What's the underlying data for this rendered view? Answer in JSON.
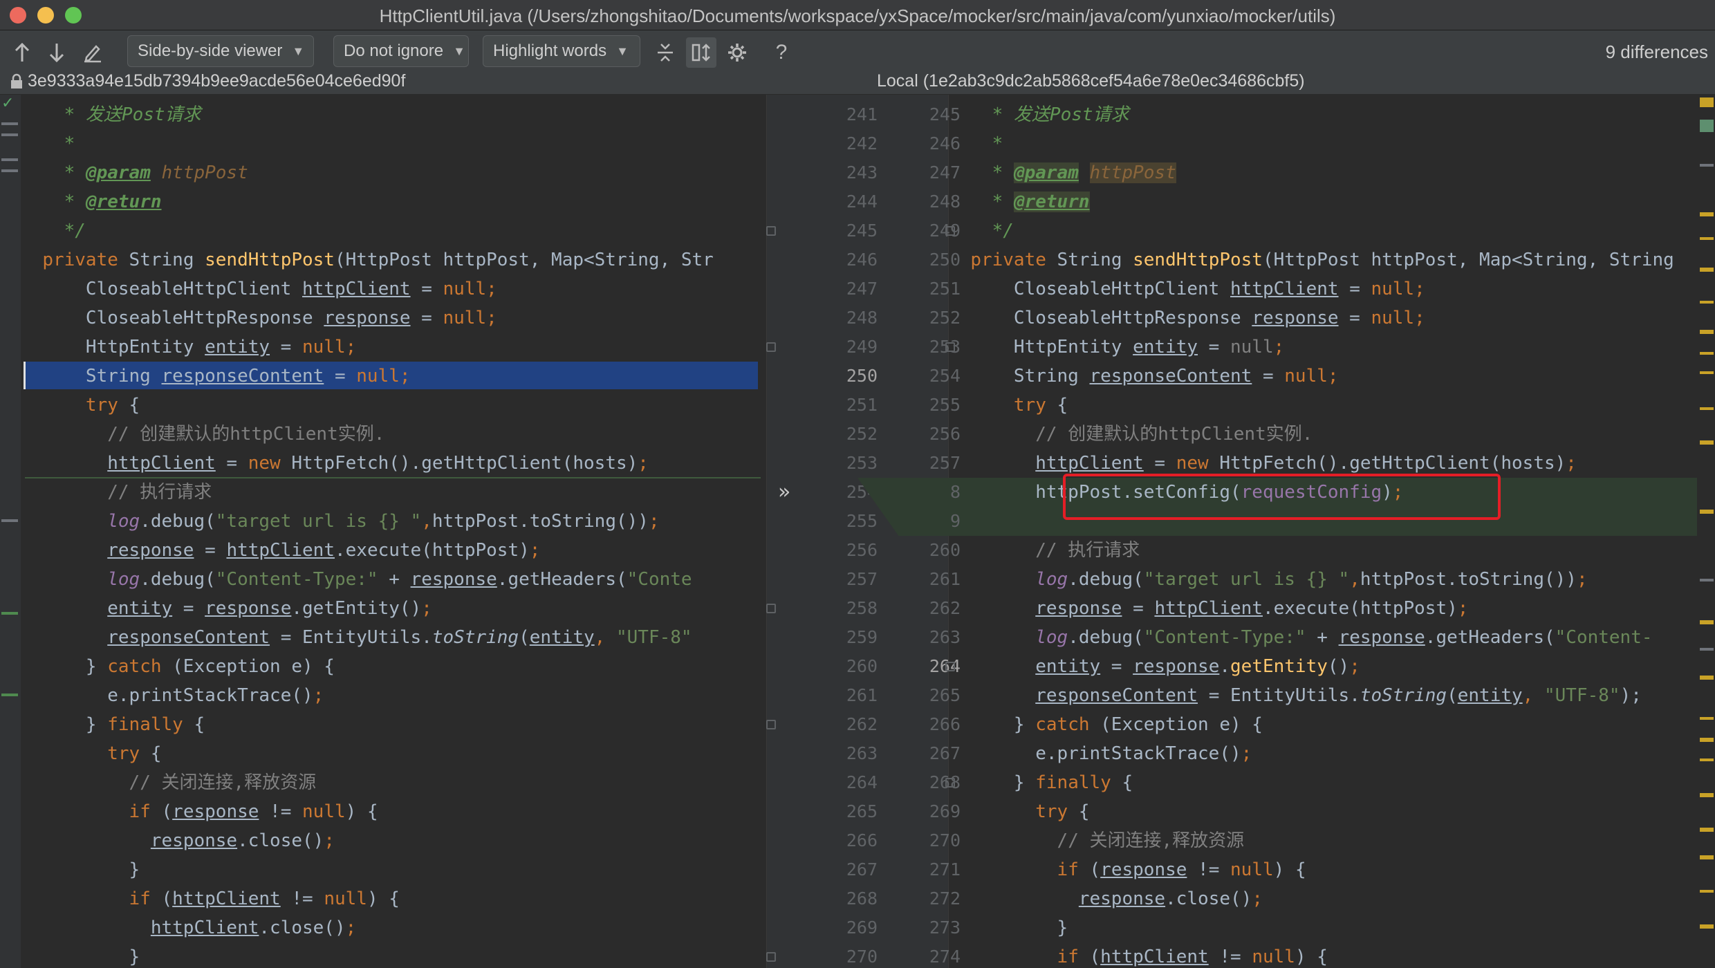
{
  "window": {
    "title": "HttpClientUtil.java (/Users/zhongshitao/Documents/workspace/yxSpace/mocker/src/main/java/com/yunxiao/mocker/utils)"
  },
  "toolbar": {
    "viewer": "Side-by-side viewer",
    "ignore": "Do not ignore",
    "highlight": "Highlight words",
    "differences": "9 differences",
    "help": "?"
  },
  "revisions": {
    "left": "3e9333a94e15db7394b9ee9acde56e04ce6ed90f",
    "right": "Local (1e2ab3c9dc2ab5868cef54a6e78e0ec34686cbf5)"
  },
  "colors": {
    "accent_selection": "#214283",
    "inserted_bg": "#2f3d30",
    "annotation_box": "#e41e26"
  },
  "icons": [
    "lock-icon",
    "arrow-up-icon",
    "arrow-down-icon",
    "edit-icon",
    "collapse-icon",
    "sync-scroll-icon",
    "gear-icon",
    "help-icon",
    "checkmark-icon",
    "apply-change-icon"
  ],
  "gutter": {
    "left_numbers": [
      241,
      242,
      243,
      244,
      245,
      246,
      247,
      248,
      249,
      250,
      251,
      252,
      253,
      254,
      255,
      256,
      257,
      258,
      259,
      260,
      261,
      262,
      263,
      264,
      265,
      266,
      267,
      268,
      269,
      270
    ],
    "right_numbers": [
      245,
      246,
      247,
      248,
      249,
      250,
      251,
      252,
      253,
      254,
      255,
      256,
      257,
      258,
      259,
      260,
      261,
      262,
      263,
      264,
      265,
      266,
      267,
      268,
      269,
      270,
      271,
      272,
      273,
      274
    ],
    "apply_arrow": "»"
  },
  "left_lines": [
    [
      [
        "    ",
        ""
      ],
      [
        "* 发送Post请求",
        "c-doc"
      ]
    ],
    [
      [
        "    ",
        ""
      ],
      [
        "*",
        "c-doc"
      ]
    ],
    [
      [
        "    ",
        ""
      ],
      [
        "* ",
        "c-doc"
      ],
      [
        "@param",
        "c-tag"
      ],
      [
        " ",
        "c-doc"
      ],
      [
        "httpPost",
        "c-pn"
      ]
    ],
    [
      [
        "    ",
        ""
      ],
      [
        "* ",
        "c-doc"
      ],
      [
        "@return",
        "c-tag"
      ]
    ],
    [
      [
        "    ",
        ""
      ],
      [
        "*/",
        "c-doc"
      ]
    ],
    [
      [
        "  ",
        ""
      ],
      [
        "private ",
        "c-kw"
      ],
      [
        "String ",
        ""
      ],
      [
        "sendHttpPost",
        "c-fn"
      ],
      [
        "(HttpPost httpPost, Map<String, Str",
        ""
      ]
    ],
    [
      [
        "      CloseableHttpClient ",
        ""
      ],
      [
        "httpClient",
        "c-u"
      ],
      [
        " = ",
        ""
      ],
      [
        "null",
        "c-kw"
      ],
      [
        ";",
        "c-kw"
      ]
    ],
    [
      [
        "      CloseableHttpResponse ",
        ""
      ],
      [
        "response",
        "c-u"
      ],
      [
        " = ",
        ""
      ],
      [
        "null",
        "c-kw"
      ],
      [
        ";",
        "c-kw"
      ]
    ],
    [
      [
        "      HttpEntity ",
        ""
      ],
      [
        "entity",
        "c-u"
      ],
      [
        " = ",
        ""
      ],
      [
        "null",
        "c-kw"
      ],
      [
        ";",
        "c-kw"
      ]
    ],
    [
      [
        "      String ",
        ""
      ],
      [
        "responseContent",
        "c-u"
      ],
      [
        " = ",
        ""
      ],
      [
        "null",
        "c-kw"
      ],
      [
        ";",
        "c-kw"
      ]
    ],
    [
      [
        "      ",
        ""
      ],
      [
        "try ",
        "c-kw"
      ],
      [
        "{",
        ""
      ]
    ],
    [
      [
        "        ",
        ""
      ],
      [
        "// 创建默认的httpClient实例.",
        "c-cm"
      ]
    ],
    [
      [
        "        ",
        ""
      ],
      [
        "httpClient",
        "c-u"
      ],
      [
        " = ",
        ""
      ],
      [
        "new ",
        "c-kw"
      ],
      [
        "HttpFetch().getHttpClient(hosts)",
        ""
      ],
      [
        ";",
        "c-kw"
      ]
    ],
    [
      [
        "        ",
        ""
      ],
      [
        "// 执行请求",
        "c-cm"
      ]
    ],
    [
      [
        "        ",
        ""
      ],
      [
        "log",
        "c-st"
      ],
      [
        ".debug(",
        ""
      ],
      [
        "\"target url is {} \"",
        "c-str"
      ],
      [
        ",",
        "c-kw"
      ],
      [
        "httpPost.toString())",
        ""
      ],
      [
        ";",
        "c-kw"
      ]
    ],
    [
      [
        "        ",
        ""
      ],
      [
        "response",
        "c-u"
      ],
      [
        " = ",
        ""
      ],
      [
        "httpClient",
        "c-u"
      ],
      [
        ".execute(httpPost)",
        ""
      ],
      [
        ";",
        "c-kw"
      ]
    ],
    [
      [
        "        ",
        ""
      ],
      [
        "log",
        "c-st"
      ],
      [
        ".debug(",
        ""
      ],
      [
        "\"Content-Type:\"",
        "c-str"
      ],
      [
        " + ",
        ""
      ],
      [
        "response",
        "c-u"
      ],
      [
        ".getHeaders(",
        ""
      ],
      [
        "\"Conte",
        "c-str"
      ]
    ],
    [
      [
        "        ",
        ""
      ],
      [
        "entity",
        "c-u"
      ],
      [
        " = ",
        ""
      ],
      [
        "response",
        "c-u"
      ],
      [
        ".getEntity()",
        ""
      ],
      [
        ";",
        "c-kw"
      ]
    ],
    [
      [
        "        ",
        ""
      ],
      [
        "responseContent",
        "c-u"
      ],
      [
        " = EntityUtils.",
        ""
      ],
      [
        "toString",
        "c-it"
      ],
      [
        "(",
        ""
      ],
      [
        "entity",
        "c-u"
      ],
      [
        ", ",
        "c-kw"
      ],
      [
        "\"UTF-8\"",
        "c-str"
      ]
    ],
    [
      [
        "      } ",
        ""
      ],
      [
        "catch ",
        "c-kw"
      ],
      [
        "(Exception e) {",
        ""
      ]
    ],
    [
      [
        "        e.printStackTrace()",
        ""
      ],
      [
        ";",
        "c-kw"
      ]
    ],
    [
      [
        "      } ",
        ""
      ],
      [
        "finally ",
        "c-kw"
      ],
      [
        "{",
        ""
      ]
    ],
    [
      [
        "        ",
        ""
      ],
      [
        "try ",
        "c-kw"
      ],
      [
        "{",
        ""
      ]
    ],
    [
      [
        "          ",
        ""
      ],
      [
        "// 关闭连接,释放资源",
        "c-cm"
      ]
    ],
    [
      [
        "          ",
        ""
      ],
      [
        "if ",
        "c-kw"
      ],
      [
        "(",
        ""
      ],
      [
        "response",
        "c-u"
      ],
      [
        " != ",
        ""
      ],
      [
        "null",
        "c-kw"
      ],
      [
        ") {",
        ""
      ]
    ],
    [
      [
        "            ",
        ""
      ],
      [
        "response",
        "c-u"
      ],
      [
        ".close()",
        ""
      ],
      [
        ";",
        "c-kw"
      ]
    ],
    [
      [
        "          }",
        ""
      ]
    ],
    [
      [
        "          ",
        ""
      ],
      [
        "if ",
        "c-kw"
      ],
      [
        "(",
        ""
      ],
      [
        "httpClient",
        "c-u"
      ],
      [
        " != ",
        ""
      ],
      [
        "null",
        "c-kw"
      ],
      [
        ") {",
        ""
      ]
    ],
    [
      [
        "            ",
        ""
      ],
      [
        "httpClient",
        "c-u"
      ],
      [
        ".close()",
        ""
      ],
      [
        ";",
        "c-kw"
      ]
    ],
    [
      [
        "          }",
        ""
      ]
    ]
  ],
  "right_lines": [
    [
      [
        "    ",
        ""
      ],
      [
        "* 发送Post请求",
        "c-doc"
      ]
    ],
    [
      [
        "    ",
        ""
      ],
      [
        "*",
        "c-doc"
      ]
    ],
    [
      [
        "    ",
        ""
      ],
      [
        "* ",
        "c-doc"
      ],
      [
        "@param",
        "c-tag bgtag"
      ],
      [
        " ",
        "c-doc"
      ],
      [
        "httpPost",
        "c-pn bgpn"
      ]
    ],
    [
      [
        "    ",
        ""
      ],
      [
        "* ",
        "c-doc"
      ],
      [
        "@return",
        "c-tag bgtag"
      ]
    ],
    [
      [
        "    ",
        ""
      ],
      [
        "*/",
        "c-doc"
      ]
    ],
    [
      [
        "  ",
        ""
      ],
      [
        "private ",
        "c-kw"
      ],
      [
        "String ",
        ""
      ],
      [
        "sendHttpPost",
        "c-fn"
      ],
      [
        "(HttpPost httpPost, Map<String, String",
        ""
      ]
    ],
    [
      [
        "      CloseableHttpClient ",
        ""
      ],
      [
        "httpClient",
        "c-u"
      ],
      [
        " = ",
        ""
      ],
      [
        "null",
        "c-kw"
      ],
      [
        ";",
        "c-kw"
      ]
    ],
    [
      [
        "      CloseableHttpResponse ",
        ""
      ],
      [
        "response",
        "c-u"
      ],
      [
        " = ",
        ""
      ],
      [
        "null",
        "c-kw"
      ],
      [
        ";",
        "c-kw"
      ]
    ],
    [
      [
        "      HttpEntity ",
        ""
      ],
      [
        "entity",
        "c-u"
      ],
      [
        " = ",
        ""
      ],
      [
        "null",
        "c-cm"
      ],
      [
        ";",
        "c-kw"
      ]
    ],
    [
      [
        "      String ",
        ""
      ],
      [
        "responseContent",
        "c-u"
      ],
      [
        " = ",
        ""
      ],
      [
        "null",
        "c-kw"
      ],
      [
        ";",
        "c-kw"
      ]
    ],
    [
      [
        "      ",
        ""
      ],
      [
        "try ",
        "c-kw"
      ],
      [
        "{",
        ""
      ]
    ],
    [
      [
        "        ",
        ""
      ],
      [
        "// 创建默认的httpClient实例.",
        "c-cm"
      ]
    ],
    [
      [
        "        ",
        ""
      ],
      [
        "httpClient",
        "c-u"
      ],
      [
        " = ",
        ""
      ],
      [
        "new ",
        "c-kw"
      ],
      [
        "HttpFetch().getHttpClient(hosts)",
        ""
      ],
      [
        ";",
        "c-kw"
      ]
    ],
    [
      [
        "        httpPost.setConfig(",
        ""
      ],
      [
        "requestConfig",
        "c-pp"
      ],
      [
        ")",
        ""
      ],
      [
        ";",
        "c-kw"
      ]
    ],
    [
      [
        "",
        ""
      ]
    ],
    [
      [
        "        ",
        ""
      ],
      [
        "// 执行请求",
        "c-cm"
      ]
    ],
    [
      [
        "        ",
        ""
      ],
      [
        "log",
        "c-st"
      ],
      [
        ".debug(",
        ""
      ],
      [
        "\"target url is {} \"",
        "c-str"
      ],
      [
        ",",
        "c-kw"
      ],
      [
        "httpPost.toString())",
        ""
      ],
      [
        ";",
        "c-kw"
      ]
    ],
    [
      [
        "        ",
        ""
      ],
      [
        "response",
        "c-u"
      ],
      [
        " = ",
        ""
      ],
      [
        "httpClient",
        "c-u"
      ],
      [
        ".execute(httpPost)",
        ""
      ],
      [
        ";",
        "c-kw"
      ]
    ],
    [
      [
        "        ",
        ""
      ],
      [
        "log",
        "c-st"
      ],
      [
        ".debug(",
        ""
      ],
      [
        "\"Content-Type:\"",
        "c-str"
      ],
      [
        " + ",
        ""
      ],
      [
        "response",
        "c-u"
      ],
      [
        ".getHeaders(",
        ""
      ],
      [
        "\"Content-",
        "c-str"
      ]
    ],
    [
      [
        "        ",
        ""
      ],
      [
        "entity",
        "c-u"
      ],
      [
        " = ",
        ""
      ],
      [
        "response",
        "c-u"
      ],
      [
        ".",
        ""
      ],
      [
        "getEntity",
        "c-fn"
      ],
      [
        "()",
        ""
      ],
      [
        ";",
        "c-kw"
      ]
    ],
    [
      [
        "        ",
        ""
      ],
      [
        "responseContent",
        "c-u"
      ],
      [
        " = EntityUtils.",
        ""
      ],
      [
        "toString",
        "c-it"
      ],
      [
        "(",
        ""
      ],
      [
        "entity",
        "c-u"
      ],
      [
        ", ",
        "c-kw"
      ],
      [
        "\"UTF-8\"",
        "c-str"
      ],
      [
        ");",
        ""
      ]
    ],
    [
      [
        "      } ",
        ""
      ],
      [
        "catch ",
        "c-kw"
      ],
      [
        "(Exception e) {",
        ""
      ]
    ],
    [
      [
        "        e.printStackTrace()",
        ""
      ],
      [
        ";",
        "c-kw"
      ]
    ],
    [
      [
        "      } ",
        ""
      ],
      [
        "finally ",
        "c-kw"
      ],
      [
        "{",
        ""
      ]
    ],
    [
      [
        "        ",
        ""
      ],
      [
        "try ",
        "c-kw"
      ],
      [
        "{",
        ""
      ]
    ],
    [
      [
        "          ",
        ""
      ],
      [
        "// 关闭连接,释放资源",
        "c-cm"
      ]
    ],
    [
      [
        "          ",
        ""
      ],
      [
        "if ",
        "c-kw"
      ],
      [
        "(",
        ""
      ],
      [
        "response",
        "c-u"
      ],
      [
        " != ",
        ""
      ],
      [
        "null",
        "c-kw"
      ],
      [
        ") {",
        ""
      ]
    ],
    [
      [
        "            ",
        ""
      ],
      [
        "response",
        "c-u"
      ],
      [
        ".close()",
        ""
      ],
      [
        ";",
        "c-kw"
      ]
    ],
    [
      [
        "          }",
        ""
      ]
    ],
    [
      [
        "          ",
        ""
      ],
      [
        "if ",
        "c-kw"
      ],
      [
        "(",
        ""
      ],
      [
        "httpClient",
        "c-u"
      ],
      [
        " != ",
        ""
      ],
      [
        "null",
        "c-kw"
      ],
      [
        ") {",
        ""
      ]
    ]
  ]
}
